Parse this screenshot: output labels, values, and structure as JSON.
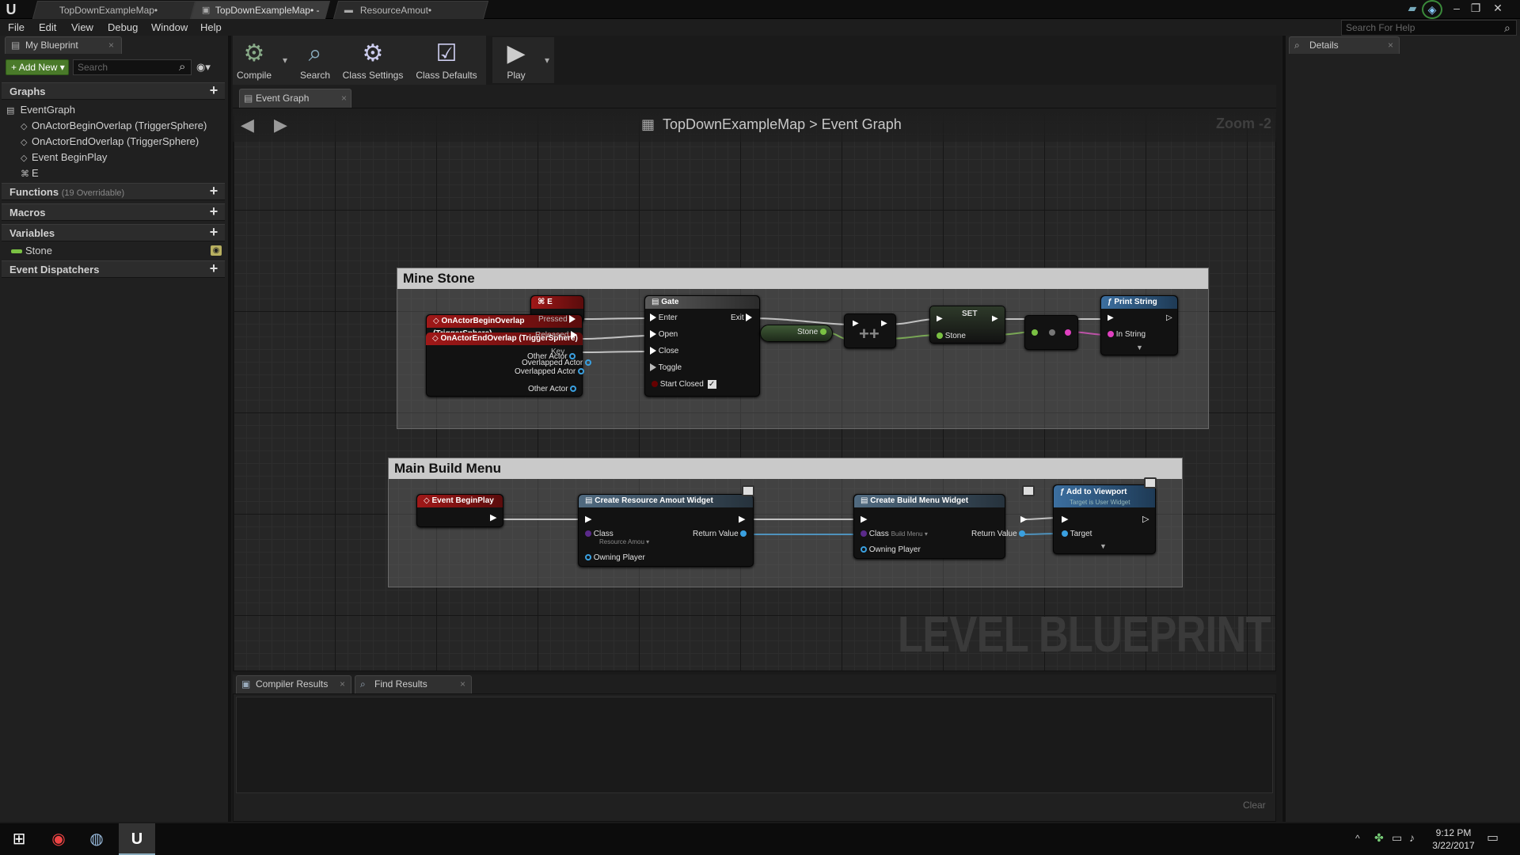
{
  "titlebar": {
    "tabs": [
      {
        "label": "TopDownExampleMap•"
      },
      {
        "label": "TopDownExampleMap• - L"
      },
      {
        "label": "ResourceAmout•"
      }
    ]
  },
  "menu": [
    "File",
    "Edit",
    "View",
    "Debug",
    "Window",
    "Help"
  ],
  "help_search": {
    "placeholder": "Search For Help"
  },
  "left_panel": {
    "tab_label": "My Blueprint",
    "add_new": "Add New",
    "search_placeholder": "Search",
    "sections": {
      "graphs": "Graphs",
      "functions": "Functions",
      "functions_sub": "(19 Overridable)",
      "macros": "Macros",
      "variables": "Variables",
      "dispatchers": "Event Dispatchers"
    },
    "graph_items": [
      "EventGraph",
      "OnActorBeginOverlap (TriggerSphere)",
      "OnActorEndOverlap (TriggerSphere)",
      "Event BeginPlay",
      "E"
    ],
    "variables": [
      "Stone"
    ]
  },
  "toolbar": {
    "compile": "Compile",
    "search": "Search",
    "class_settings": "Class Settings",
    "class_defaults": "Class Defaults",
    "play": "Play"
  },
  "graph_tab": "Event Graph",
  "breadcrumb": {
    "map": "TopDownExampleMap",
    "sep": ">",
    "graph": "Event Graph"
  },
  "zoom": "Zoom -2",
  "watermark": "LEVEL BLUEPRINT",
  "comments": {
    "mine": "Mine Stone",
    "build": "Main Build Menu"
  },
  "nodes": {
    "e_key": {
      "title": "E",
      "pins": [
        "Pressed",
        "Released",
        "Key"
      ]
    },
    "begin_overlap": {
      "title": "OnActorBeginOverlap (TriggerSphere)",
      "pins": [
        "Overlapped Actor",
        "Other Actor"
      ]
    },
    "end_overlap": {
      "title": "OnActorEndOverlap (TriggerSphere)",
      "pins": [
        "Overlapped Actor",
        "Other Actor"
      ]
    },
    "gate": {
      "title": "Gate",
      "pins": [
        "Enter",
        "Open",
        "Close",
        "Toggle",
        "Start Closed"
      ],
      "exit": "Exit"
    },
    "stone_get": {
      "label": "Stone"
    },
    "set": {
      "title": "SET",
      "pin": "Stone"
    },
    "print": {
      "title": "Print String",
      "pin": "In String"
    },
    "begin_play": {
      "title": "Event BeginPlay"
    },
    "create_resource": {
      "title": "Create Resource Amout Widget",
      "class": "Class",
      "class_val": "Resource Amou",
      "return": "Return Value",
      "owner": "Owning Player"
    },
    "create_build": {
      "title": "Create Build Menu Widget",
      "class": "Class",
      "class_val": "Build Menu",
      "return": "Return Value",
      "owner": "Owning Player"
    },
    "add_viewport": {
      "title": "Add to Viewport",
      "sub": "Target is User Widget",
      "pin": "Target"
    }
  },
  "bottom": {
    "compiler_results": "Compiler Results",
    "find_results": "Find Results",
    "clear": "Clear"
  },
  "details": {
    "tab_label": "Details"
  },
  "clock": {
    "time": "9:12 PM",
    "date": "3/22/2017"
  }
}
